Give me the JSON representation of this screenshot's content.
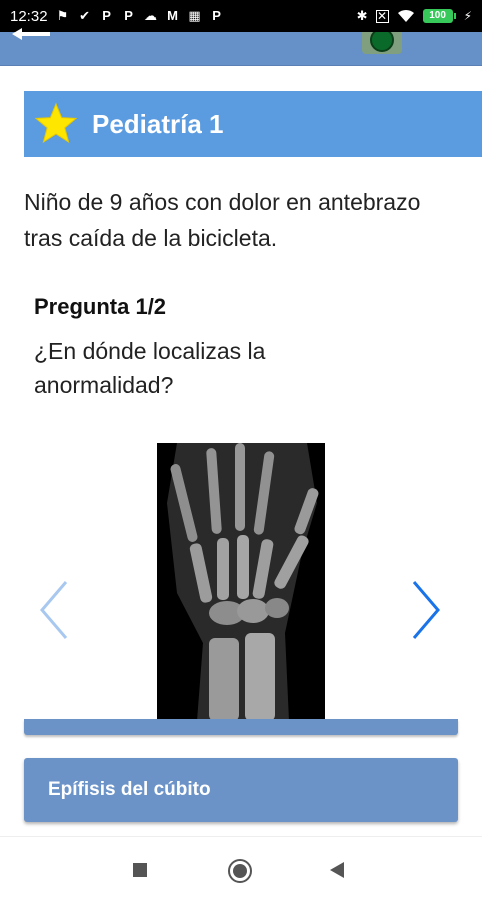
{
  "status_bar": {
    "time": "12:32",
    "left_icons": [
      "shield-icon",
      "check-circle-icon",
      "p-icon",
      "p-icon",
      "cloud-icon",
      "gmail-icon",
      "trash-icon",
      "p-icon"
    ],
    "right_icons": [
      "bluetooth-icon",
      "close-box-icon",
      "wifi-icon"
    ],
    "battery_level": "100"
  },
  "app_bar": {
    "bg_color": "#6690c8"
  },
  "title_banner": {
    "title": "Pediatría 1",
    "bg_color": "#5b9be0",
    "icon": "star-icon"
  },
  "case": {
    "description": "Niño de 9 años con dolor en antebrazo tras caída de la bicicleta."
  },
  "question": {
    "header": "Pregunta 1/2",
    "text": "¿En dónde localizas la anormalidad?"
  },
  "answers": [
    {
      "label": ""
    },
    {
      "label": "Epífisis del cúbito"
    }
  ],
  "colors": {
    "answer_bg": "#6b93c8",
    "accent_blue": "#1a73e8"
  }
}
